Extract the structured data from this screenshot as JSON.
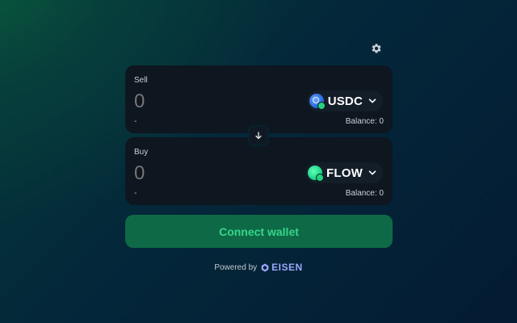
{
  "header": {
    "settings_icon": "gear-icon"
  },
  "sell": {
    "label": "Sell",
    "amount_placeholder": "0",
    "usd_value": "-",
    "token": {
      "symbol": "USDC",
      "icon": "usdc-token-icon",
      "color": "#2d6fe0"
    },
    "balance": "Balance: 0"
  },
  "swap_direction_icon": "arrow-down-icon",
  "buy": {
    "label": "Buy",
    "amount_placeholder": "0",
    "usd_value": "-",
    "token": {
      "symbol": "FLOW",
      "icon": "flow-token-icon",
      "color": "#1fd58a"
    },
    "balance": "Balance: 0"
  },
  "connect": {
    "label": "Connect wallet"
  },
  "footer": {
    "powered_by": "Powered by",
    "brand": "EISEN"
  },
  "colors": {
    "panel": "#0e1620",
    "accent_green": "#36d68a",
    "button_bg": "#0e6a46",
    "brand": "#9aa6ff"
  }
}
